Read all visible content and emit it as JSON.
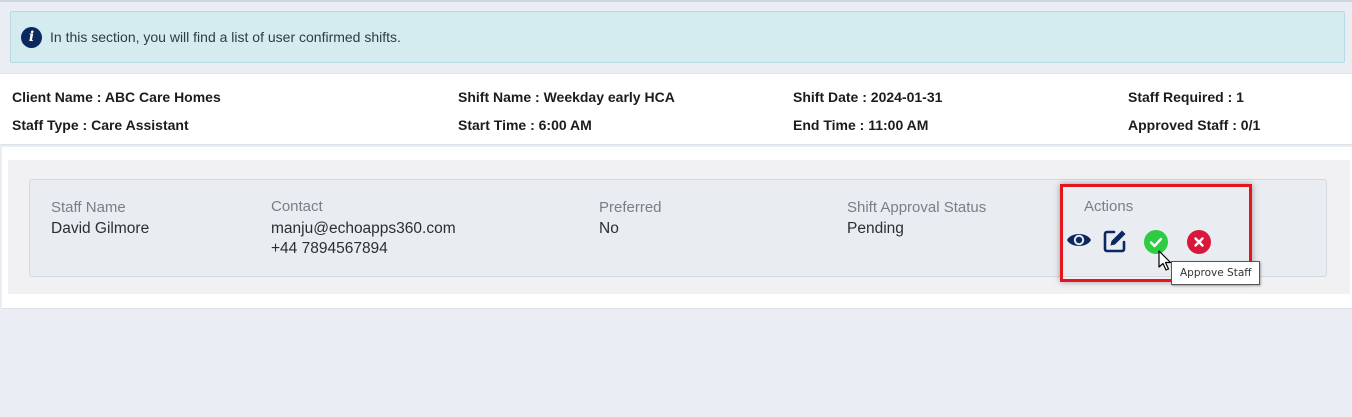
{
  "alert": {
    "icon": "info-icon",
    "text": "In this section, you will find a list of user confirmed shifts."
  },
  "summary": {
    "client_name": "Client Name : ABC Care Homes",
    "staff_type": "Staff Type : Care Assistant",
    "shift_name": "Shift Name : Weekday early HCA",
    "start_time": "Start Time : 6:00 AM",
    "shift_date": "Shift Date : 2024-01-31",
    "end_time": "End Time : 11:00 AM",
    "staff_required": "Staff Required : 1",
    "approved_staff": "Approved Staff : 0/1"
  },
  "staff_card": {
    "columns": {
      "staff_name": "Staff Name",
      "contact": "Contact",
      "preferred": "Preferred",
      "approval_status": "Shift Approval Status",
      "actions": "Actions"
    },
    "values": {
      "staff_name": "David Gilmore",
      "email": "manju@echoapps360.com",
      "phone": "+44 7894567894",
      "preferred": "No",
      "approval_status": "Pending"
    },
    "actions": [
      {
        "icon": "eye-icon",
        "color": "#0b2860"
      },
      {
        "icon": "edit-icon",
        "color": "#0b2860"
      },
      {
        "icon": "check-circle-icon",
        "color": "#2ecc40"
      },
      {
        "icon": "x-circle-icon",
        "color": "#d9163c"
      }
    ]
  },
  "tooltip": {
    "text": "Approve Staff"
  },
  "colors": {
    "highlight": "#e4161b",
    "alert_bg": "#d4ebf0",
    "navy": "#0b2860"
  }
}
